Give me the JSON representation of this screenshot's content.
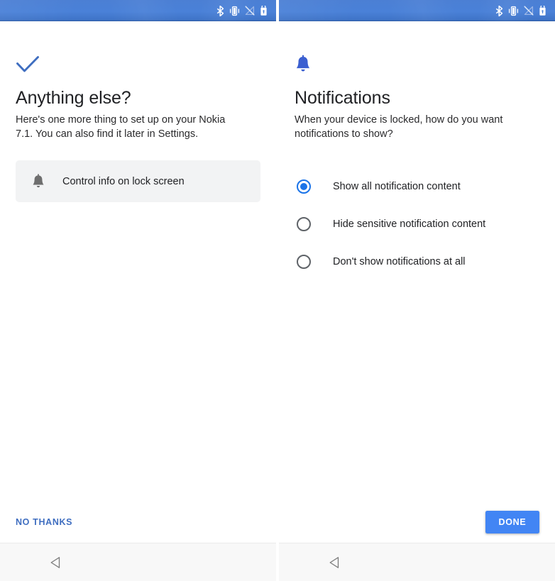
{
  "statusbar": {
    "icons": [
      {
        "name": "bluetooth-icon",
        "label": "Bluetooth"
      },
      {
        "name": "vibrate-icon",
        "label": "Vibrate"
      },
      {
        "name": "signal-off-icon",
        "label": "No signal"
      },
      {
        "name": "battery-icon",
        "label": "Battery"
      }
    ],
    "background_color": "#4a81d8"
  },
  "left_screen": {
    "hero_icon": "checkmark-icon",
    "hero_icon_color": "#3f6ec0",
    "title": "Anything else?",
    "subtitle": "Here's one more thing to set up on your Nokia 7.1. You can also find it later in Settings.",
    "option_card": {
      "icon": "bell-icon",
      "icon_color": "#6e6e6e",
      "label": "Control info on lock screen",
      "background_color": "#f2f3f4"
    },
    "action": {
      "no_thanks_label": "NO THANKS",
      "no_thanks_color": "#3f6ec0"
    },
    "navbar": {
      "back_icon": "back-triangle-icon"
    }
  },
  "right_screen": {
    "hero_icon": "bell-icon",
    "hero_icon_color": "#3b5fd0",
    "title": "Notifications",
    "subtitle": "When your device is locked, how do you want notifications to show?",
    "radio_group": {
      "name": "lockscreen-notifications",
      "selected_index": 0,
      "accent_color": "#1a73e8",
      "options": [
        {
          "label": "Show all notification content",
          "checked": true
        },
        {
          "label": "Hide sensitive notification content",
          "checked": false
        },
        {
          "label": "Don't show notifications at all",
          "checked": false
        }
      ]
    },
    "action": {
      "done_label": "DONE",
      "done_color": "#4285f4"
    },
    "navbar": {
      "back_icon": "back-triangle-icon"
    }
  }
}
